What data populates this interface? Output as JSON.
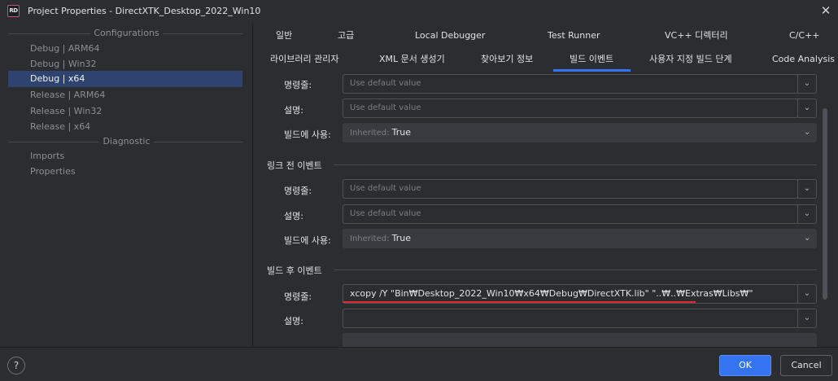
{
  "window": {
    "icon_text": "RD",
    "title": "Project Properties - DirectXTK_Desktop_2022_Win10",
    "close_glyph": "✕"
  },
  "sidebar": {
    "configurations_header": "Configurations",
    "items": [
      {
        "label": "Debug | ARM64",
        "selected": false
      },
      {
        "label": "Debug | Win32",
        "selected": false
      },
      {
        "label": "Debug | x64",
        "selected": true
      },
      {
        "label": "Release | ARM64",
        "selected": false
      },
      {
        "label": "Release | Win32",
        "selected": false
      },
      {
        "label": "Release | x64",
        "selected": false
      }
    ],
    "diagnostic_header": "Diagnostic",
    "diagnostic_items": [
      "Imports",
      "Properties"
    ]
  },
  "tabs": {
    "row1": [
      "일반",
      "고급",
      "Local Debugger",
      "Test Runner",
      "VC++ 디렉터리",
      "C/C++"
    ],
    "row2": [
      "라이브러리 관리자",
      "XML 문서 생성기",
      "찾아보기 정보",
      "빌드 이벤트",
      "사용자 지정 빌드 단계",
      "Code Analysis"
    ],
    "active": "빌드 이벤트"
  },
  "content": {
    "top_group": {
      "command_label": "명령줄:",
      "command_placeholder": "Use default value",
      "description_label": "설명:",
      "description_placeholder": "Use default value",
      "use_in_build_label": "빌드에 사용:",
      "use_in_build_inherited": "Inherited:",
      "use_in_build_value": "True"
    },
    "prelink_group": {
      "header": "링크 전 이벤트",
      "command_label": "명령줄:",
      "command_placeholder": "Use default value",
      "description_label": "설명:",
      "description_placeholder": "Use default value",
      "use_in_build_label": "빌드에 사용:",
      "use_in_build_inherited": "Inherited:",
      "use_in_build_value": "True"
    },
    "postbuild_group": {
      "header": "빌드 후 이벤트",
      "command_label": "명령줄:",
      "command_value": "xcopy /Y \"Bin₩Desktop_2022_Win10₩x64₩Debug₩DirectXTK.lib\" \"..₩..₩Extras₩Libs₩\"",
      "description_label": "설명:",
      "description_value": ""
    },
    "accent_red": "#e0272b"
  },
  "footer": {
    "help_glyph": "?",
    "ok_label": "OK",
    "cancel_label": "Cancel"
  },
  "colors": {
    "background": "#2b2d30",
    "selection": "#2e436e",
    "accent": "#3574f0"
  }
}
